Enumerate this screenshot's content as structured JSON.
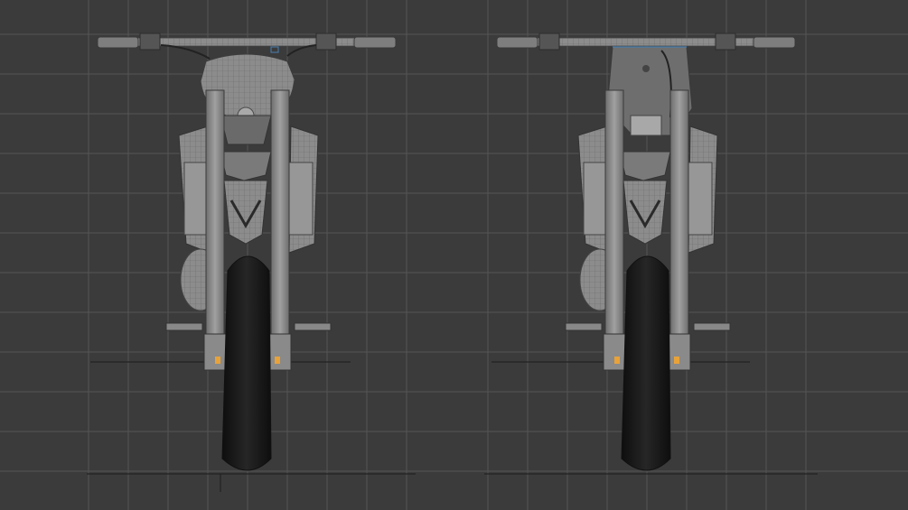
{
  "scene": {
    "background_color": "#3b3b3b",
    "grid_color": "#5a5a5a",
    "axis_color": "#1e1e1e",
    "mesh_color": "#8a8a8a",
    "wire_color": "#5e5e5e",
    "tire_color": "#1a1a1a",
    "indicator_color": "#e8a23a",
    "selection_color": "#4a7fb0"
  },
  "views": [
    {
      "id": "front-view-headlight-mask",
      "variant": "round-headlight"
    },
    {
      "id": "front-view-number-plate",
      "variant": "number-plate"
    }
  ]
}
